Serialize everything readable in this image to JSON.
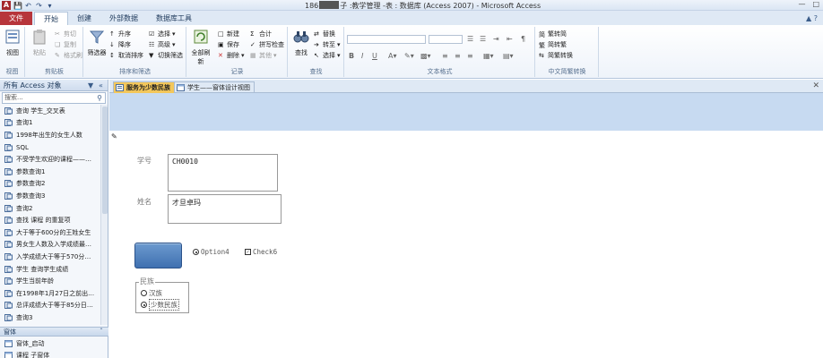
{
  "window": {
    "title_prefix": "186",
    "title_suffix": "子 :教学管理 -表 : 数据库 (Access 2007) - Microsoft Access",
    "app_icon": "A"
  },
  "ribbon_tabs": [
    "文件",
    "开始",
    "创建",
    "外部数据",
    "数据库工具"
  ],
  "ribbon_groups": {
    "views": {
      "label": "视图",
      "btn": "视图"
    },
    "clipboard": {
      "label": "剪贴板",
      "paste": "粘贴",
      "cut": "剪切",
      "copy": "复制",
      "format_painter": "格式刷"
    },
    "sort_filter": {
      "label": "排序和筛选",
      "filter": "筛选器",
      "asc": "升序",
      "desc": "降序",
      "remove_sort": "取消排序",
      "selection": "选择",
      "advanced": "高级",
      "toggle_filter": "切换筛选"
    },
    "records": {
      "label": "记录",
      "refresh": "全部刷新",
      "new": "新建",
      "save": "保存",
      "delete": "删除",
      "totals": "合计",
      "spelling": "拼写检查",
      "more": "其他"
    },
    "find": {
      "label": "查找",
      "find": "查找",
      "replace": "替换",
      "goto": "转至",
      "select": "选择"
    },
    "text_format": {
      "label": "文本格式"
    },
    "chinese": {
      "label": "中文简繁转换",
      "to_simplified": "繁转简",
      "to_traditional": "简转繁",
      "convert": "简繁转换"
    }
  },
  "nav": {
    "header": "所有 Access 对象",
    "search_placeholder": "搜索...",
    "items": [
      "查询 学生_交叉表",
      "查询1",
      "1998年出生的女生人数",
      "SQL",
      "不受学生欢迎的课程——…",
      "参数查询1",
      "参数查询2",
      "参数查询3",
      "查询2",
      "查找 课程 的重复项",
      "大于等于600分的王姓女生",
      "男女生人数及入学成绩最…",
      "入学成绩大于等于570分…",
      "学生 查询学生成绩",
      "学生当前年龄",
      "在1998年1月27日之前出…",
      "总评成绩大于等于85分日…",
      "查询3"
    ],
    "forms_group": "窗体",
    "form_items": [
      "窗体_启动",
      "课程 子窗体"
    ]
  },
  "doc_tabs": [
    "服务为少数民族",
    "学生——窗体设计视图"
  ],
  "form": {
    "student_id_label": "学号",
    "student_id_value": "CH0010",
    "name_label": "姓名",
    "name_value": "才旦卓玛",
    "option4_label": "Option4",
    "check6_label": "Check6",
    "nation_frame_label": "民族",
    "nation_options": [
      "汉族",
      "少数民族"
    ]
  },
  "colors": {
    "file_tab": "#b7353b",
    "form_header": "#c7daf1",
    "active_doc_tab": "#f3c75b",
    "command_button": "#4a7bbd"
  }
}
